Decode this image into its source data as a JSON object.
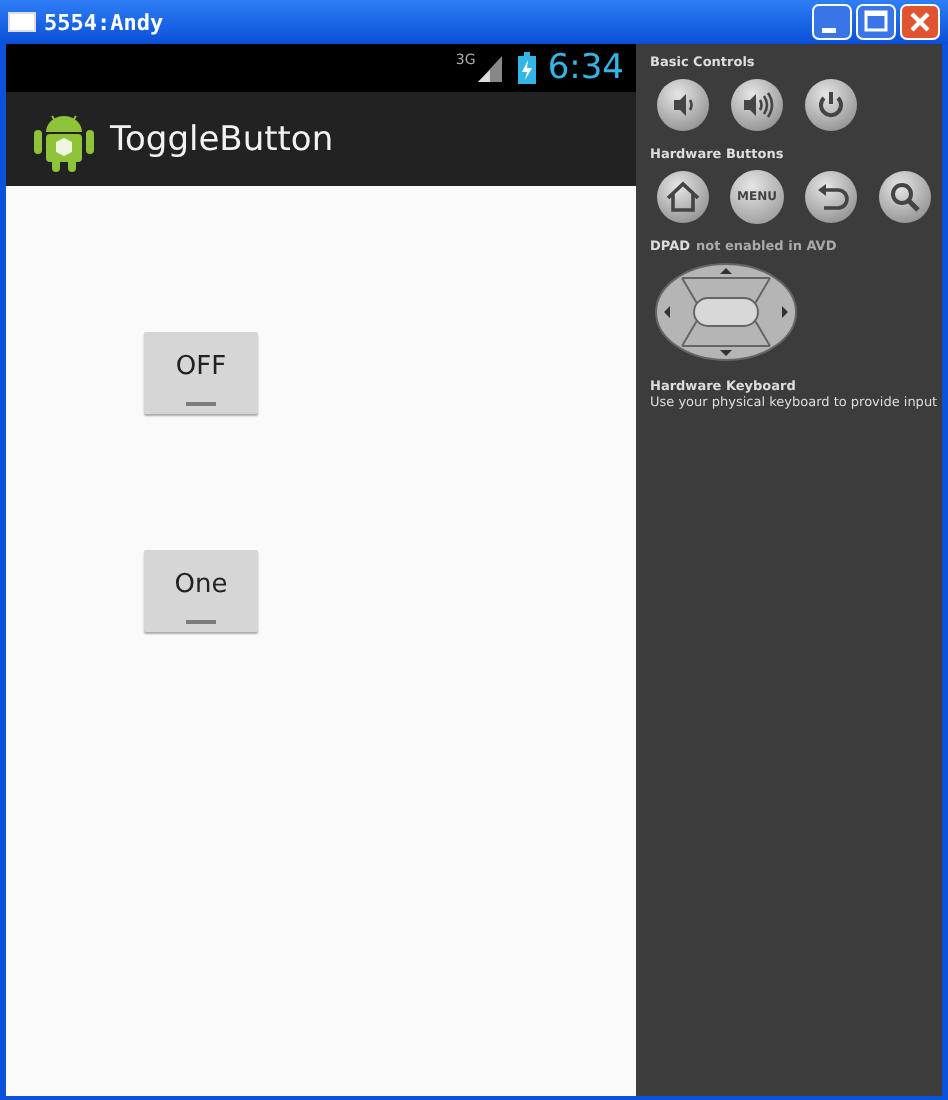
{
  "window": {
    "title": "5554:Andy"
  },
  "status_bar": {
    "network": "3G",
    "time": "6:34"
  },
  "action_bar": {
    "title": "ToggleButton"
  },
  "toggle_buttons": [
    {
      "label": "OFF",
      "checked": false
    },
    {
      "label": "One",
      "checked": false
    }
  ],
  "controls": {
    "basic_controls": {
      "title": "Basic Controls"
    },
    "hardware_buttons": {
      "title": "Hardware Buttons",
      "menu_label": "MENU"
    },
    "dpad": {
      "label": "DPAD",
      "note": "not enabled in AVD"
    },
    "keyboard": {
      "title": "Hardware Keyboard",
      "note": "Use your physical keyboard to provide input"
    }
  }
}
